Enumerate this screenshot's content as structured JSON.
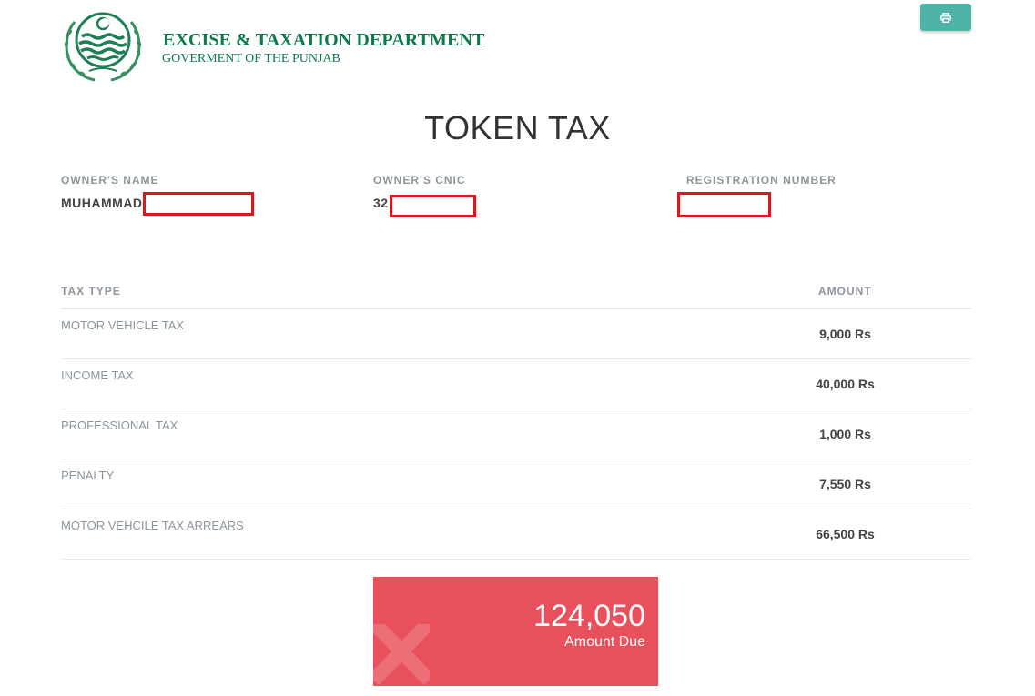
{
  "header": {
    "department": "EXCISE & TAXATION DEPARTMENT",
    "government": "GOVERMENT OF THE PUNJAB",
    "logo_icon": "punjab-seal-icon",
    "print_icon": "printer-icon",
    "brand_color": "#0f7a4a",
    "print_button_color": "#4fb4a8"
  },
  "page_title": "TOKEN TAX",
  "owner": {
    "name_label": "OWNER'S NAME",
    "name_value": "MUHAMMAD",
    "cnic_label": "OWNER'S CNIC",
    "cnic_value": "32",
    "registration_label": "REGISTRATION NUMBER",
    "registration_value": ""
  },
  "table": {
    "headers": {
      "tax_type": "TAX TYPE",
      "amount": "AMOUNT"
    },
    "rows": [
      {
        "type": "MOTOR VEHICLE TAX",
        "amount": "9,000 Rs"
      },
      {
        "type": "INCOME TAX",
        "amount": "40,000 Rs"
      },
      {
        "type": "PROFESSIONAL TAX",
        "amount": "1,000 Rs"
      },
      {
        "type": "PENALTY",
        "amount": "7,550 Rs"
      },
      {
        "type": "MOTOR VEHCILE TAX ARREARS",
        "amount": "66,500 Rs"
      }
    ]
  },
  "due": {
    "value": "124,050",
    "label": "Amount Due",
    "icon": "close-x-icon",
    "color": "#e8505b"
  }
}
